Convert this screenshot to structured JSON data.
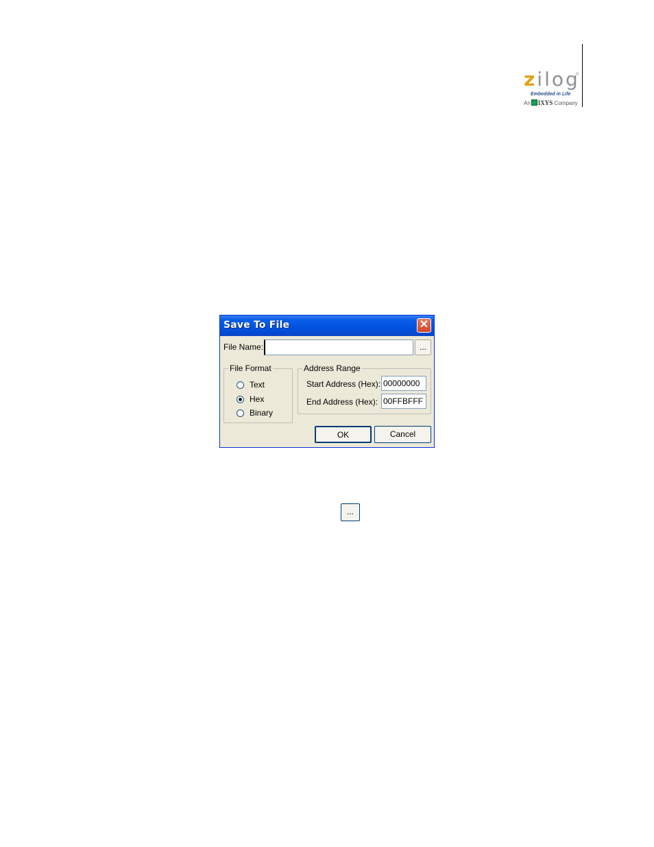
{
  "logo": {
    "word": "zilog",
    "tagline": "Embedded in Life",
    "company_prefix": "An",
    "company_name": "IXYS",
    "company_suffix": "Company",
    "colors": {
      "z": "#e0a31a",
      "word": "#8c9094",
      "tagline": "#2a4d8f",
      "ixys_box": "#1d9e5a"
    }
  },
  "dialog": {
    "title": "Save To File",
    "close_icon": "close-x",
    "file_name_label": "File Name:",
    "file_name_value": "",
    "browse_label": "...",
    "file_format": {
      "title": "File Format",
      "options": [
        {
          "label": "Text",
          "checked": false
        },
        {
          "label": "Hex",
          "checked": true
        },
        {
          "label": "Binary",
          "checked": false
        }
      ]
    },
    "address_range": {
      "title": "Address Range",
      "start_label": "Start Address (Hex):",
      "start_value": "00000000",
      "end_label": "End Address (Hex):",
      "end_value": "00FFBFFF"
    },
    "ok_label": "OK",
    "cancel_label": "Cancel",
    "colors": {
      "titlebar": "#0052e0",
      "face": "#ece9d8",
      "close": "#d44322"
    }
  },
  "standalone_browse_label": "..."
}
